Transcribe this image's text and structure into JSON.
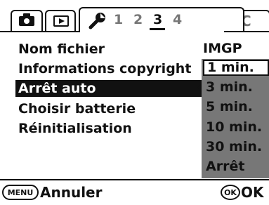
{
  "tabs": {
    "camera_icon": "camera-icon",
    "playback_icon": "playback-icon",
    "setup_icon": "wrench-icon",
    "pages": [
      "1",
      "2",
      "3",
      "4"
    ],
    "active_page": "3",
    "custom_label": "C"
  },
  "menu": {
    "items": [
      "Nom fichier",
      "Informations copyright",
      "Arrêt auto",
      "Choisir batterie",
      "Réinitialisation"
    ],
    "selected_index": 2,
    "first_item_value": "IMGP"
  },
  "dropdown": {
    "options": [
      "1 min.",
      "3 min.",
      "5 min.",
      "10 min.",
      "30 min.",
      "Arrêt"
    ],
    "selected_index": 0
  },
  "footer": {
    "menu_key": "MENU",
    "cancel_label": "Annuler",
    "ok_key": "OK",
    "ok_label": "OK"
  },
  "colors": {
    "background": "#ffffff",
    "text": "#111111",
    "highlight": "#111111",
    "dropdown_bg": "#777777",
    "inactive_text": "#777777"
  }
}
